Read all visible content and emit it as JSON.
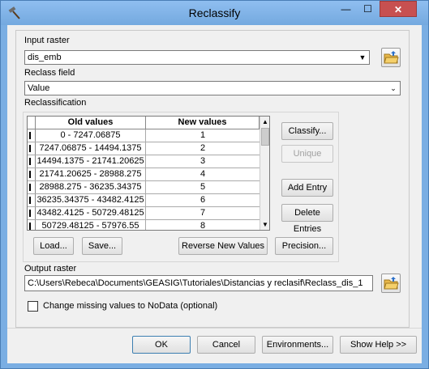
{
  "window": {
    "title": "Reclassify",
    "controls": {
      "minimize": "—",
      "maximize": "☐",
      "close": "✕"
    }
  },
  "input_raster": {
    "label": "Input raster",
    "value": "dis_emb"
  },
  "reclass_field": {
    "label": "Reclass field",
    "value": "Value"
  },
  "reclassification": {
    "label": "Reclassification",
    "columns": [
      "Old values",
      "New values"
    ],
    "rows": [
      {
        "old": "0 - 7247.06875",
        "new": "1"
      },
      {
        "old": "7247.06875 - 14494.1375",
        "new": "2"
      },
      {
        "old": "14494.1375 - 21741.20625",
        "new": "3"
      },
      {
        "old": "21741.20625 - 28988.275",
        "new": "4"
      },
      {
        "old": "28988.275 - 36235.34375",
        "new": "5"
      },
      {
        "old": "36235.34375 - 43482.4125",
        "new": "6"
      },
      {
        "old": "43482.4125 - 50729.48125",
        "new": "7"
      },
      {
        "old": "50729.48125 - 57976.55",
        "new": "8"
      }
    ],
    "buttons": {
      "classify": "Classify...",
      "unique": "Unique",
      "add_entry": "Add Entry",
      "delete_entries": "Delete Entries",
      "load": "Load...",
      "save": "Save...",
      "reverse": "Reverse New Values",
      "precision": "Precision..."
    }
  },
  "output_raster": {
    "label": "Output raster",
    "value": "C:\\Users\\Rebeca\\Documents\\GEASIG\\Tutoriales\\Distancias y reclasif\\Reclass_dis_1"
  },
  "nodata_option": {
    "label": "Change missing values to NoData (optional)",
    "checked": false
  },
  "footer": {
    "ok": "OK",
    "cancel": "Cancel",
    "environments": "Environments...",
    "show_help": "Show Help >>"
  }
}
